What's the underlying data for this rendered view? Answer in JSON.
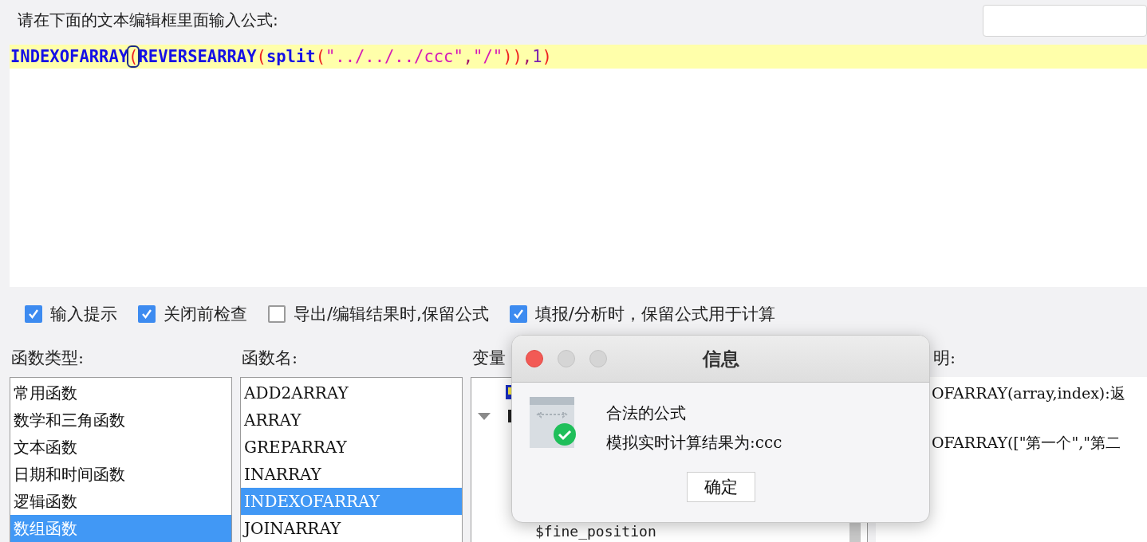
{
  "prompt": "请在下面的文本编辑框里面输入公式:",
  "formula": {
    "tokens": [
      {
        "text": "INDEXOFARRAY",
        "kind": "function",
        "matched": false
      },
      {
        "text": "(",
        "kind": "paren",
        "matched": true
      },
      {
        "text": "REVERSEARRAY",
        "kind": "function",
        "matched": false
      },
      {
        "text": "(",
        "kind": "paren",
        "matched": false
      },
      {
        "text": "split",
        "kind": "function",
        "matched": false
      },
      {
        "text": "(",
        "kind": "paren",
        "matched": false
      },
      {
        "text": "\"../../../ccc\"",
        "kind": "string",
        "matched": false
      },
      {
        "text": ",",
        "kind": "separator",
        "matched": false
      },
      {
        "text": "\"/\"",
        "kind": "string",
        "matched": false
      },
      {
        "text": "))",
        "kind": "paren",
        "matched": false
      },
      {
        "text": ",",
        "kind": "separator",
        "matched": false
      },
      {
        "text": "1",
        "kind": "number",
        "matched": false
      },
      {
        "text": ")",
        "kind": "paren",
        "matched": false
      }
    ]
  },
  "options": [
    {
      "label": "输入提示",
      "checked": true
    },
    {
      "label": "关闭前检查",
      "checked": true
    },
    {
      "label": "导出/编辑结果时,保留公式",
      "checked": false
    },
    {
      "label": "填报/分析时，保留公式用于计算",
      "checked": true
    }
  ],
  "function_types": {
    "label": "函数类型:",
    "items": [
      {
        "label": "常用函数",
        "selected": false
      },
      {
        "label": "数学和三角函数",
        "selected": false
      },
      {
        "label": "文本函数",
        "selected": false
      },
      {
        "label": "日期和时间函数",
        "selected": false
      },
      {
        "label": "逻辑函数",
        "selected": false
      },
      {
        "label": "数组函数",
        "selected": true
      }
    ]
  },
  "function_names": {
    "label": "函数名:",
    "items": [
      {
        "label": "ADD2ARRAY",
        "selected": false
      },
      {
        "label": "ARRAY",
        "selected": false
      },
      {
        "label": "GREPARRAY",
        "selected": false
      },
      {
        "label": "INARRAY",
        "selected": false
      },
      {
        "label": "INDEXOFARRAY",
        "selected": true
      },
      {
        "label": "JOINARRAY",
        "selected": false
      }
    ]
  },
  "variables": {
    "label": "变量",
    "items": [
      "$fine_position"
    ]
  },
  "description": {
    "label": "明:",
    "lines": [
      "OFARRAY(array,index):返",
      "OFARRAY([\"第一个\",\"第二"
    ]
  },
  "dialog": {
    "title": "信息",
    "lines": [
      "合法的公式",
      "模拟实时计算结果为:ccc"
    ],
    "button": "确定"
  }
}
